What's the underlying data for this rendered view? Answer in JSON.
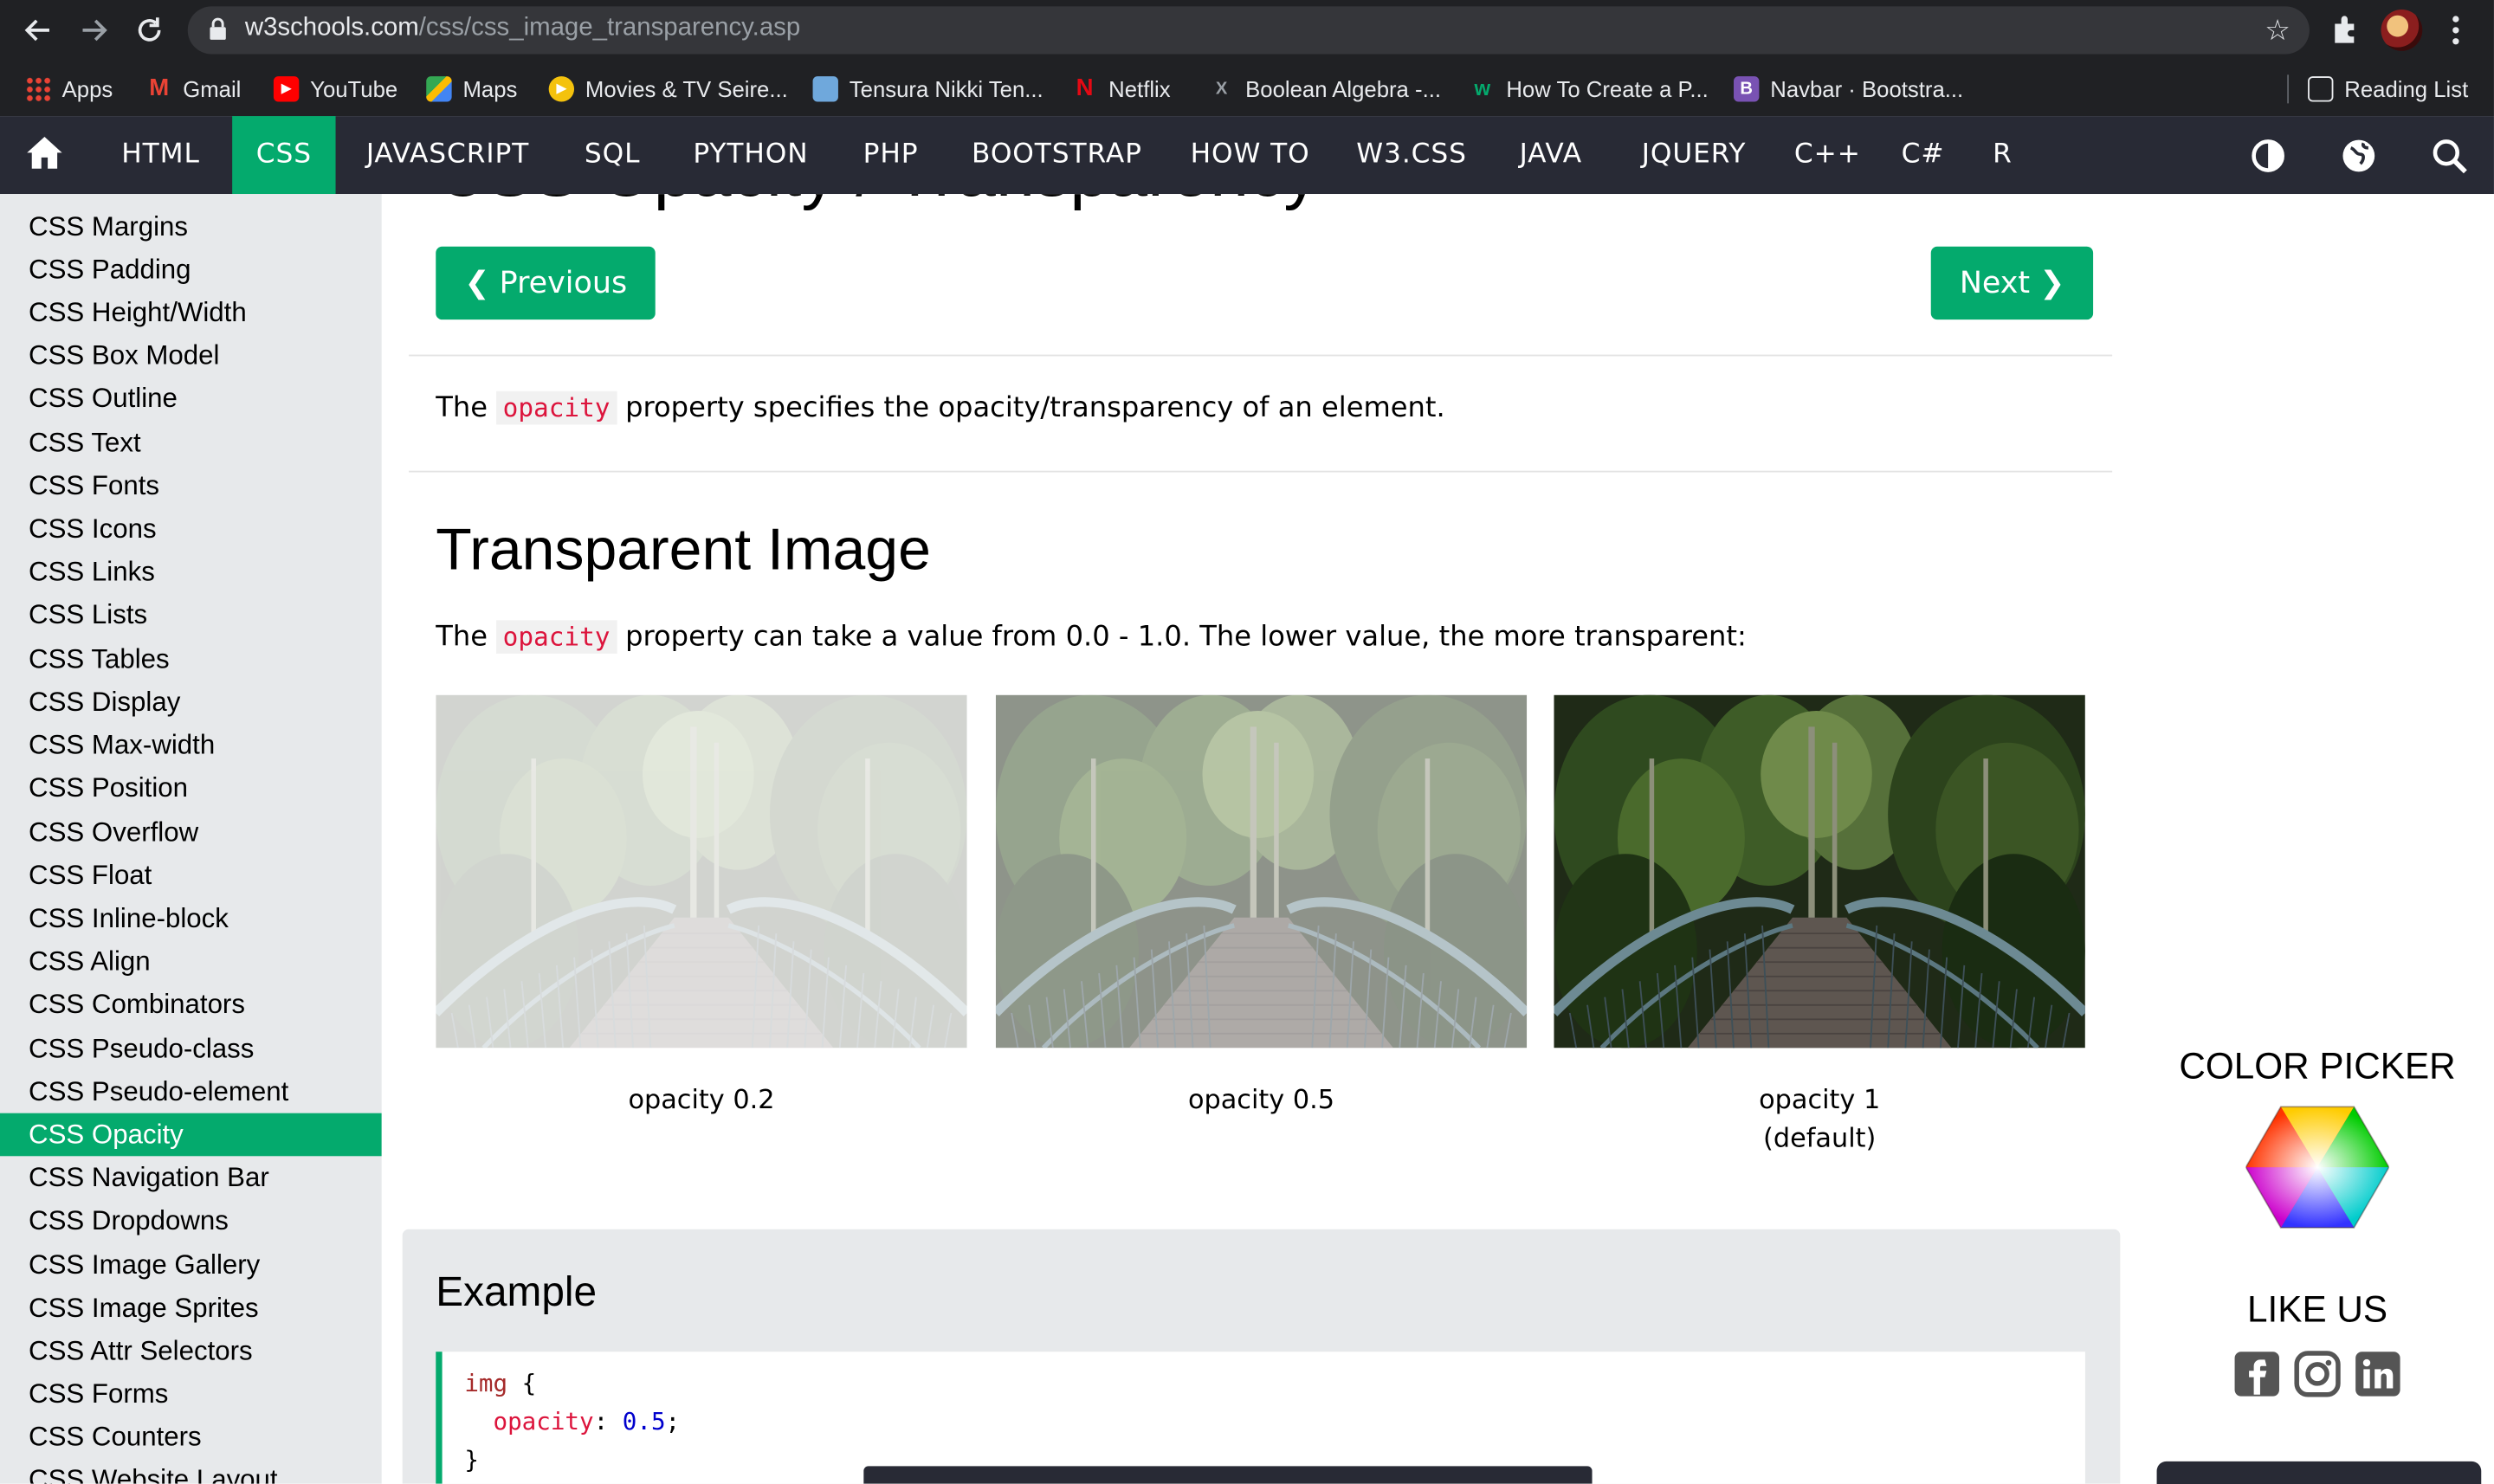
{
  "browser": {
    "url_domain": "w3schools.com",
    "url_path": "/css/css_image_transparency.asp",
    "bookmarks": [
      {
        "label": "Apps",
        "icon": "apps-grid-icon"
      },
      {
        "label": "Gmail",
        "icon": "gmail-icon"
      },
      {
        "label": "YouTube",
        "icon": "youtube-icon"
      },
      {
        "label": "Maps",
        "icon": "maps-icon"
      },
      {
        "label": "Movies & TV Seire...",
        "icon": "movies-icon"
      },
      {
        "label": "Tensura Nikki Ten...",
        "icon": "tensura-icon"
      },
      {
        "label": "Netflix",
        "icon": "netflix-icon"
      },
      {
        "label": "Boolean Algebra -...",
        "icon": "boolean-icon"
      },
      {
        "label": "How To Create a P...",
        "icon": "w-icon"
      },
      {
        "label": "Navbar · Bootstra...",
        "icon": "bootstrap-icon"
      }
    ],
    "reading_list": "Reading List"
  },
  "topnav": {
    "items": [
      "HTML",
      "CSS",
      "JAVASCRIPT",
      "SQL",
      "PYTHON",
      "PHP",
      "BOOTSTRAP",
      "HOW TO",
      "W3.CSS",
      "JAVA",
      "JQUERY",
      "C++",
      "C#",
      "R"
    ],
    "active": "CSS",
    "accent": "#04aa6d",
    "bg": "#282a35"
  },
  "sidebar": {
    "items": [
      "CSS Margins",
      "CSS Padding",
      "CSS Height/Width",
      "CSS Box Model",
      "CSS Outline",
      "CSS Text",
      "CSS Fonts",
      "CSS Icons",
      "CSS Links",
      "CSS Lists",
      "CSS Tables",
      "CSS Display",
      "CSS Max-width",
      "CSS Position",
      "CSS Overflow",
      "CSS Float",
      "CSS Inline-block",
      "CSS Align",
      "CSS Combinators",
      "CSS Pseudo-class",
      "CSS Pseudo-element",
      "CSS Opacity",
      "CSS Navigation Bar",
      "CSS Dropdowns",
      "CSS Image Gallery",
      "CSS Image Sprites",
      "CSS Attr Selectors",
      "CSS Forms",
      "CSS Counters",
      "CSS Website Layout"
    ],
    "active": "CSS Opacity"
  },
  "main": {
    "title": "CSS Opacity / Transparency",
    "prev_label": "❮ Previous",
    "next_label": "Next ❯",
    "intro_before": "The",
    "intro_code": "opacity",
    "intro_after": "property specifies the opacity/transparency of an element.",
    "section_title": "Transparent Image",
    "p2_before": "The",
    "p2_code": "opacity",
    "p2_after": "property can take a value from 0.0 - 1.0. The lower value, the more transparent:",
    "images": [
      {
        "caption": "opacity 0.2",
        "opacity": 0.2
      },
      {
        "caption": "opacity 0.5",
        "opacity": 0.5
      },
      {
        "caption": "opacity 1",
        "caption2": "(default)",
        "opacity": 1
      }
    ],
    "example_title": "Example",
    "code_selector": "img",
    "code_prop": "opacity",
    "code_value": "0.5"
  },
  "rightcol": {
    "color_picker": "COLOR PICKER",
    "like_us": "LIKE US",
    "social": [
      "facebook-icon",
      "instagram-icon",
      "linkedin-icon"
    ]
  }
}
